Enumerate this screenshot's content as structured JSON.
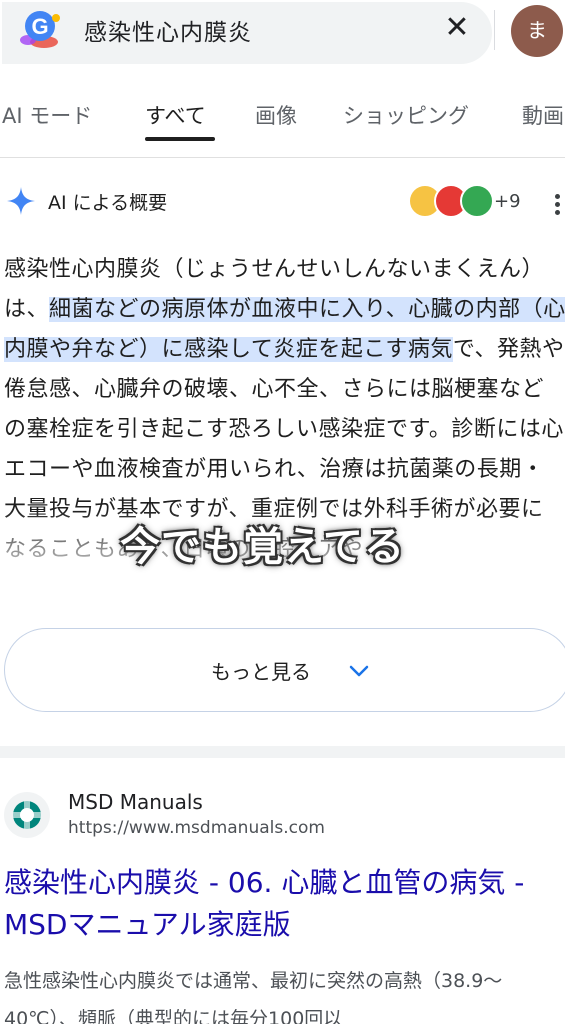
{
  "search": {
    "query": "感染性心内膜炎",
    "clear_icon": "close-icon",
    "avatar_initial": "ま"
  },
  "tabs": [
    {
      "label": "AI モード"
    },
    {
      "label": "すべて",
      "active": true
    },
    {
      "label": "画像"
    },
    {
      "label": "ショッピング"
    },
    {
      "label": "動画"
    }
  ],
  "ai_overview": {
    "title": "AI による概要",
    "more_sources": "+9",
    "text_intro": "感染性心内膜炎（じょうせんせいしんないまくえん）は、",
    "text_highlight": "細菌などの病原体が血液中に入り、心臓の内部（心内膜や弁など）に感染して炎症を起こす病気",
    "text_rest": "で、発熱や倦怠感、心臓弁の破壊、心不全、さらには脳梗塞などの塞栓症を引き起こす恐ろしい感染症です。診断には心エコーや血液検査が用いられ、治療は抗菌薬の長期・大量投与が基本ですが、重症例では外科手術が必要になることもあり、日頃の口腔ケアや",
    "show_more": "もっと見る"
  },
  "overlay_caption": "今でも覚えてる",
  "result": {
    "site_name": "MSD Manuals",
    "url": "https://www.msdmanuals.com",
    "title": "感染性心内膜炎 - 06. 心臓と血管の病気 - MSDマニュアル家庭版",
    "snippet": "急性感染性心内膜炎では通常、最初に突然の高熱（38.9〜40℃）、頻脈（典型的には毎分100回以"
  },
  "colors": {
    "link": "#1a0dab",
    "highlight": "#d3e3fd",
    "avatar": "#8d5b4c"
  }
}
